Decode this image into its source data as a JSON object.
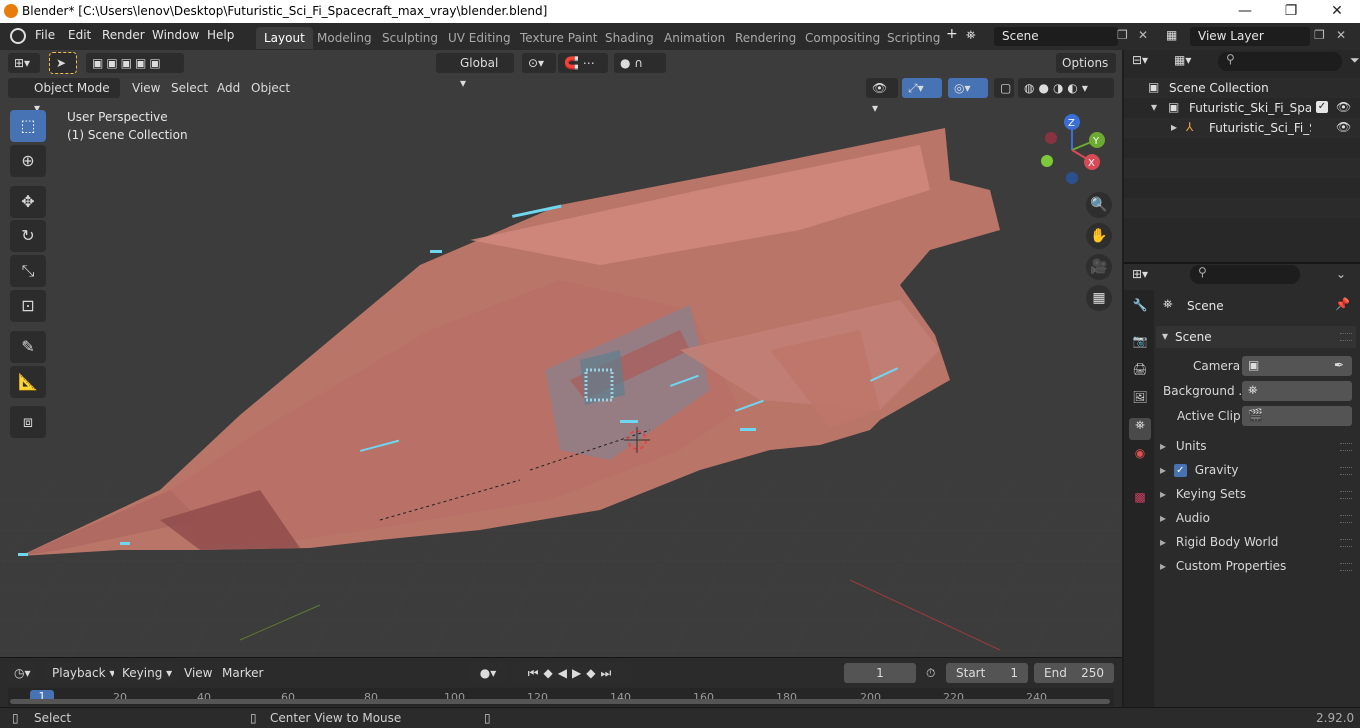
{
  "window": {
    "title": "Blender* [C:\\Users\\lenov\\Desktop\\Futuristic_Sci_Fi_Spacecraft_max_vray\\blender.blend]"
  },
  "menu": [
    "File",
    "Edit",
    "Render",
    "Window",
    "Help"
  ],
  "workspace_tabs": [
    "Layout",
    "Modeling",
    "Sculpting",
    "UV Editing",
    "Texture Paint",
    "Shading",
    "Animation",
    "Rendering",
    "Compositing",
    "Scripting"
  ],
  "scene_name": "Scene",
  "view_layer": "View Layer",
  "viewport": {
    "orientation": "Global",
    "options": "Options",
    "mode": "Object Mode",
    "header_menu": [
      "View",
      "Select",
      "Add",
      "Object"
    ],
    "perspective": "User Perspective",
    "collection": "(1) Scene Collection",
    "gizmo": {
      "z": "Z",
      "y": "Y",
      "x": "X"
    }
  },
  "outliner": {
    "root": "Scene Collection",
    "items": [
      {
        "label": "Futuristic_Ski_Fi_Spacec"
      },
      {
        "label": "Futuristic_Sci_Fi_Spa"
      }
    ]
  },
  "properties": {
    "header": "Scene",
    "section": "Scene",
    "fields": [
      {
        "label": "Camera"
      },
      {
        "label": "Background ..."
      },
      {
        "label": "Active Clip"
      }
    ],
    "panels": [
      "Units",
      "Gravity",
      "Keying Sets",
      "Audio",
      "Rigid Body World",
      "Custom Properties"
    ],
    "gravity_checked": true
  },
  "timeline": {
    "menu": [
      "Playback",
      "Keying",
      "View",
      "Marker"
    ],
    "current_frame": "1",
    "start_label": "Start",
    "start": "1",
    "end_label": "End",
    "end": "250",
    "ticks": [
      "1",
      "20",
      "40",
      "60",
      "80",
      "100",
      "120",
      "140",
      "160",
      "180",
      "200",
      "220",
      "240"
    ]
  },
  "status": {
    "left": "Select",
    "middle": "Center View to Mouse",
    "version": "2.92.0"
  },
  "colors": {
    "accent": "#4772b3",
    "ship": "#c87b6e",
    "ship_dark": "#9a5a55",
    "lights": "#6fd6f0"
  }
}
